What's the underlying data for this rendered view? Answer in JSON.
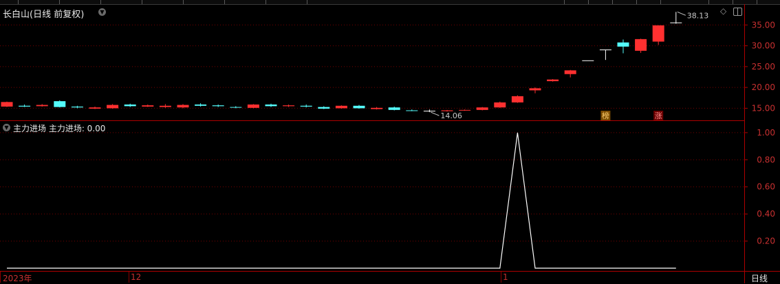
{
  "header": {
    "title": "长白山(日线 前复权)"
  },
  "indicator": {
    "title": "主力进场  主力进场: 0.00"
  },
  "period_label": "日线",
  "x_axis": {
    "labels": [
      "2023年",
      "12",
      "1"
    ]
  },
  "colors": {
    "up": "#ff3030",
    "down": "#54fcfc",
    "flat": "#ffffff",
    "grid": "#7a0000",
    "axis": "#b00000",
    "tick_label": "#c83030",
    "signal_line": "#ffffff"
  },
  "chart_data": [
    {
      "type": "candlestick",
      "title": "长白山(日线 前复权)",
      "yticks": [
        15.0,
        20.0,
        25.0,
        30.0,
        35.0
      ],
      "ytick_labels": [
        "15.00",
        "20.00",
        "25.00",
        "30.00",
        "35.00"
      ],
      "ylim": [
        12.1,
        40.0
      ],
      "grid": true,
      "candles": [
        {
          "o": 15.4,
          "c": 16.5,
          "h": 16.6,
          "l": 15.3
        },
        {
          "o": 15.6,
          "c": 15.4,
          "h": 15.9,
          "l": 15.3
        },
        {
          "o": 15.5,
          "c": 15.8,
          "h": 16.0,
          "l": 15.4
        },
        {
          "o": 16.7,
          "c": 15.3,
          "h": 16.9,
          "l": 15.2
        },
        {
          "o": 15.4,
          "c": 15.2,
          "h": 15.6,
          "l": 15.0
        },
        {
          "o": 14.9,
          "c": 15.2,
          "h": 15.4,
          "l": 14.8
        },
        {
          "o": 15.0,
          "c": 15.8,
          "h": 16.0,
          "l": 14.9
        },
        {
          "o": 15.9,
          "c": 15.5,
          "h": 16.1,
          "l": 15.3
        },
        {
          "o": 15.4,
          "c": 15.7,
          "h": 15.9,
          "l": 15.3
        },
        {
          "o": 15.3,
          "c": 15.6,
          "h": 16.0,
          "l": 15.1
        },
        {
          "o": 15.2,
          "c": 15.8,
          "h": 16.0,
          "l": 15.0
        },
        {
          "o": 15.9,
          "c": 15.6,
          "h": 16.2,
          "l": 15.4
        },
        {
          "o": 15.7,
          "c": 15.5,
          "h": 15.9,
          "l": 15.3
        },
        {
          "o": 15.3,
          "c": 15.2,
          "h": 15.5,
          "l": 15.0
        },
        {
          "o": 15.1,
          "c": 15.9,
          "h": 16.0,
          "l": 15.0
        },
        {
          "o": 15.9,
          "c": 15.5,
          "h": 16.1,
          "l": 15.3
        },
        {
          "o": 15.5,
          "c": 15.7,
          "h": 15.9,
          "l": 15.3
        },
        {
          "o": 15.6,
          "c": 15.4,
          "h": 15.9,
          "l": 15.2
        },
        {
          "o": 15.3,
          "c": 14.9,
          "h": 15.5,
          "l": 14.8
        },
        {
          "o": 15.0,
          "c": 15.6,
          "h": 15.7,
          "l": 14.9
        },
        {
          "o": 15.6,
          "c": 15.0,
          "h": 15.8,
          "l": 14.9
        },
        {
          "o": 14.8,
          "c": 15.1,
          "h": 15.3,
          "l": 14.7
        },
        {
          "o": 15.2,
          "c": 14.6,
          "h": 15.4,
          "l": 14.5
        },
        {
          "o": 14.5,
          "c": 14.4,
          "h": 14.7,
          "l": 14.3
        },
        {
          "o": 14.4,
          "c": 14.4,
          "h": 14.7,
          "l": 14.06
        },
        {
          "o": 14.3,
          "c": 14.5,
          "h": 14.6,
          "l": 14.2
        },
        {
          "o": 14.5,
          "c": 14.6,
          "h": 14.7,
          "l": 14.4
        },
        {
          "o": 14.6,
          "c": 15.2,
          "h": 15.3,
          "l": 14.5
        },
        {
          "o": 15.2,
          "c": 16.4,
          "h": 16.6,
          "l": 15.1
        },
        {
          "o": 16.4,
          "c": 17.9,
          "h": 18.1,
          "l": 16.3
        },
        {
          "o": 19.3,
          "c": 19.8,
          "h": 20.0,
          "l": 18.6
        },
        {
          "o": 21.5,
          "c": 21.9,
          "h": 22.0,
          "l": 21.4
        },
        {
          "o": 23.2,
          "c": 24.1,
          "h": 24.2,
          "l": 22.4
        },
        {
          "o": 26.5,
          "c": 26.5,
          "h": 26.5,
          "l": 26.5
        },
        {
          "o": 29.1,
          "c": 29.1,
          "h": 29.1,
          "l": 26.6
        },
        {
          "o": 30.8,
          "c": 29.8,
          "h": 31.5,
          "l": 28.2
        },
        {
          "o": 28.8,
          "c": 31.6,
          "h": 31.7,
          "l": 28.3
        },
        {
          "o": 31.0,
          "c": 34.9,
          "h": 34.9,
          "l": 30.2
        },
        {
          "o": 35.6,
          "c": 35.6,
          "h": 38.13,
          "l": 35.3
        }
      ],
      "annotations": [
        {
          "text": "38.13",
          "index": 38,
          "value": 38.13
        },
        {
          "text": "14.06",
          "index": 24,
          "value": 14.06
        }
      ],
      "markers": [
        {
          "text": "榜",
          "index": 34,
          "bg": "#7a4a00",
          "fg": "#ffd070"
        },
        {
          "text": "涨",
          "index": 37,
          "bg": "#6a0000",
          "fg": "#ff9090"
        }
      ]
    },
    {
      "type": "line",
      "title": "主力进场",
      "yticks": [
        0.2,
        0.4,
        0.6,
        0.8,
        1.0
      ],
      "ytick_labels": [
        "0.20",
        "0.40",
        "0.60",
        "0.80",
        "1.00"
      ],
      "ylim": [
        0,
        1.035
      ],
      "grid": true,
      "series": [
        {
          "name": "主力进场",
          "values": [
            0,
            0,
            0,
            0,
            0,
            0,
            0,
            0,
            0,
            0,
            0,
            0,
            0,
            0,
            0,
            0,
            0,
            0,
            0,
            0,
            0,
            0,
            0,
            0,
            0,
            0,
            0,
            0,
            0,
            1,
            0,
            0,
            0,
            0,
            0,
            0,
            0,
            0,
            0
          ]
        }
      ]
    }
  ]
}
